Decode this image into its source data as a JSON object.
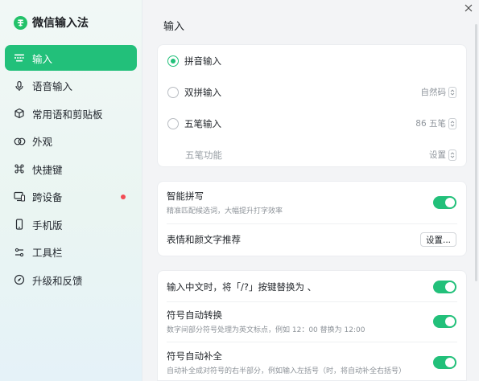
{
  "app": {
    "name": "微信输入法"
  },
  "sidebar": {
    "items": [
      {
        "label": "输入",
        "icon": "keyboard-icon",
        "active": true,
        "badge": false
      },
      {
        "label": "语音输入",
        "icon": "microphone-icon",
        "active": false,
        "badge": false
      },
      {
        "label": "常用语和剪贴板",
        "icon": "cube-icon",
        "active": false,
        "badge": false
      },
      {
        "label": "外观",
        "icon": "appearance-rings-icon",
        "active": false,
        "badge": false
      },
      {
        "label": "快捷键",
        "icon": "command-icon",
        "active": false,
        "badge": false
      },
      {
        "label": "跨设备",
        "icon": "devices-icon",
        "active": false,
        "badge": true
      },
      {
        "label": "手机版",
        "icon": "phone-icon",
        "active": false,
        "badge": false
      },
      {
        "label": "工具栏",
        "icon": "toolbar-icon",
        "active": false,
        "badge": false
      },
      {
        "label": "升级和反馈",
        "icon": "compass-icon",
        "active": false,
        "badge": false
      }
    ],
    "accent_color": "#22c07a",
    "badge_color": "#f24b54"
  },
  "main": {
    "section_title": "输入",
    "input_methods": {
      "pinyin": {
        "label": "拼音输入",
        "selected": true
      },
      "shuangpin": {
        "label": "双拼输入",
        "selected": false,
        "select_value": "自然码"
      },
      "wubi": {
        "label": "五笔输入",
        "selected": false,
        "select_value": "86 五笔"
      },
      "wubi_functions": {
        "label": "五笔功能",
        "select_value": "设置"
      }
    },
    "smart": {
      "smart_pinyin": {
        "title": "智能拼写",
        "desc": "精准匹配候选词，大幅提升打字效率",
        "enabled": true
      },
      "emoji": {
        "title": "表情和颜文字推荐",
        "button": "设置..."
      }
    },
    "symbols": {
      "replace": {
        "title": "输入中文时，将「/?」按键替换为 、",
        "enabled": true
      },
      "auto_convert": {
        "title": "符号自动转换",
        "desc": "数字间部分符号处理为英文标点，例如 12：00 替换为 12:00",
        "enabled": true
      },
      "auto_complete": {
        "title": "符号自动补全",
        "desc": "自动补全成对符号的右半部分，例如输入左括号（时，将自动补全右括号）",
        "enabled": true
      }
    }
  }
}
